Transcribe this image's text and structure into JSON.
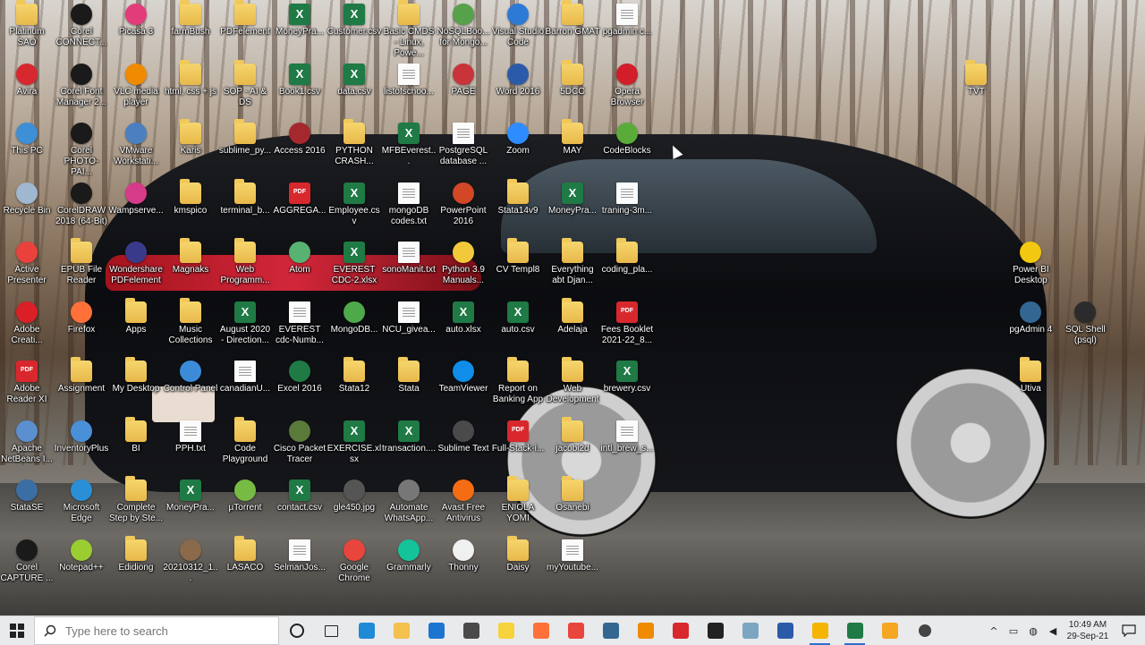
{
  "desktop": {
    "icons": [
      {
        "label": "Platinum SAO",
        "type": "folder"
      },
      {
        "label": "Corel CONNECT...",
        "type": "app",
        "color": "#1a1a1a"
      },
      {
        "label": "Picasa 3",
        "type": "app",
        "color": "#e23c7a"
      },
      {
        "label": "farmBush",
        "type": "folder"
      },
      {
        "label": "PDFelement",
        "type": "folder"
      },
      {
        "label": "MoneyPra...",
        "type": "excel"
      },
      {
        "label": "Customer.csv",
        "type": "excel"
      },
      {
        "label": "Basic CMDS - Linux, Powe...",
        "type": "folder"
      },
      {
        "label": "NoSQLBoo... for Mongo...",
        "type": "app",
        "color": "#56a14a"
      },
      {
        "label": "Visual Studio Code",
        "type": "app",
        "color": "#2c7ad6"
      },
      {
        "label": "Barron GMAT",
        "type": "folder"
      },
      {
        "label": "pgadmin c...",
        "type": "file"
      },
      {
        "label": "Avira",
        "type": "app",
        "color": "#d7282f"
      },
      {
        "label": "Corel Font Manager 2...",
        "type": "app",
        "color": "#1a1a1a"
      },
      {
        "label": "VLC media player",
        "type": "app",
        "color": "#f08a00"
      },
      {
        "label": "html, css + js",
        "type": "folder"
      },
      {
        "label": "SOP - AI & DS",
        "type": "folder"
      },
      {
        "label": "Book1.csv",
        "type": "excel"
      },
      {
        "label": "data.csv",
        "type": "excel"
      },
      {
        "label": "listofschoo...",
        "type": "file"
      },
      {
        "label": "PAGE",
        "type": "app",
        "color": "#c9333a"
      },
      {
        "label": "Word 2016",
        "type": "app",
        "color": "#2b5ba8"
      },
      {
        "label": "5DCC",
        "type": "folder"
      },
      {
        "label": "Opera Browser",
        "type": "app",
        "color": "#d21d2a"
      },
      {
        "label": "TVT",
        "type": "folder"
      },
      {
        "label": "This PC",
        "type": "app",
        "color": "#3d8fd6"
      },
      {
        "label": "Corel PHOTO-PAI...",
        "type": "app",
        "color": "#1a1a1a"
      },
      {
        "label": "VMware Workstati...",
        "type": "app",
        "color": "#4c7fc0"
      },
      {
        "label": "Karis",
        "type": "folder"
      },
      {
        "label": "sublime_py...",
        "type": "folder"
      },
      {
        "label": "Access 2016",
        "type": "app",
        "color": "#a6282f"
      },
      {
        "label": "PYTHON CRASH...",
        "type": "folder"
      },
      {
        "label": "MFBEverest...",
        "type": "excel"
      },
      {
        "label": "PostgreSQL database ...",
        "type": "file"
      },
      {
        "label": "Zoom",
        "type": "app",
        "color": "#2d8cff"
      },
      {
        "label": "MAY",
        "type": "folder"
      },
      {
        "label": "CodeBlocks",
        "type": "app",
        "color": "#5bab3a"
      },
      {
        "label": "Recycle Bin",
        "type": "app",
        "color": "#9fb7cf"
      },
      {
        "label": "CorelDRAW 2018 (64-Bit)",
        "type": "app",
        "color": "#1a1a1a"
      },
      {
        "label": "Wampserve...",
        "type": "app",
        "color": "#d63b8a"
      },
      {
        "label": "kmspico",
        "type": "folder"
      },
      {
        "label": "terminal_b...",
        "type": "folder"
      },
      {
        "label": "AGGREGA...",
        "type": "pdf"
      },
      {
        "label": "Employee.csv",
        "type": "excel"
      },
      {
        "label": "mongoDB codes.txt",
        "type": "file"
      },
      {
        "label": "PowerPoint 2016",
        "type": "app",
        "color": "#d24726"
      },
      {
        "label": "Stata14v9",
        "type": "folder"
      },
      {
        "label": "MoneyPra...",
        "type": "excel"
      },
      {
        "label": "traning-3m...",
        "type": "file"
      },
      {
        "label": "Active Presenter",
        "type": "app",
        "color": "#e9413c"
      },
      {
        "label": "EPUB File Reader",
        "type": "folder"
      },
      {
        "label": "Wondershare PDFelement",
        "type": "app",
        "color": "#3a3a8a"
      },
      {
        "label": "Magnaks",
        "type": "folder"
      },
      {
        "label": "Web Programm...",
        "type": "folder"
      },
      {
        "label": "Atom",
        "type": "app",
        "color": "#58b272"
      },
      {
        "label": "EVEREST CDC-2.xlsx",
        "type": "excel"
      },
      {
        "label": "sonoManit.txt",
        "type": "file"
      },
      {
        "label": "Python 3.9 Manuals...",
        "type": "app",
        "color": "#f2c93b"
      },
      {
        "label": "CV Templ8",
        "type": "folder"
      },
      {
        "label": "Everything abt Djan...",
        "type": "folder"
      },
      {
        "label": "coding_pla...",
        "type": "folder"
      },
      {
        "label": "Power BI Desktop",
        "type": "app",
        "color": "#f2c811"
      },
      {
        "label": "Adobe Creati...",
        "type": "app",
        "color": "#da1f26"
      },
      {
        "label": "Firefox",
        "type": "app",
        "color": "#ff7139"
      },
      {
        "label": "Apps",
        "type": "folder"
      },
      {
        "label": "Music Collections",
        "type": "folder"
      },
      {
        "label": "August 2020 - Direction...",
        "type": "excel"
      },
      {
        "label": "EVEREST cdc-Numb...",
        "type": "file"
      },
      {
        "label": "MongoDB...",
        "type": "app",
        "color": "#4ea94b"
      },
      {
        "label": "NCU_givea...",
        "type": "file"
      },
      {
        "label": "auto.xlsx",
        "type": "excel"
      },
      {
        "label": "auto.csv",
        "type": "excel"
      },
      {
        "label": "Adelaja",
        "type": "folder"
      },
      {
        "label": "Fees Booklet 2021-22_8...",
        "type": "pdf"
      },
      {
        "label": "pgAdmin 4",
        "type": "app",
        "color": "#336791"
      },
      {
        "label": "SQL Shell (psql)",
        "type": "app",
        "color": "#2b2b2b"
      },
      {
        "label": "Adobe Reader XI",
        "type": "pdf"
      },
      {
        "label": "Assignment",
        "type": "folder"
      },
      {
        "label": "My Desktop",
        "type": "folder"
      },
      {
        "label": "Control Panel",
        "type": "app",
        "color": "#3c8bd9"
      },
      {
        "label": "canadianU...",
        "type": "file"
      },
      {
        "label": "Excel 2016",
        "type": "app",
        "color": "#1f7a45"
      },
      {
        "label": "Stata12",
        "type": "folder"
      },
      {
        "label": "Stata",
        "type": "folder"
      },
      {
        "label": "TeamViewer",
        "type": "app",
        "color": "#0e8ee9"
      },
      {
        "label": "Report on Banking App",
        "type": "folder"
      },
      {
        "label": "Web Development",
        "type": "folder"
      },
      {
        "label": "brewery.csv",
        "type": "excel"
      },
      {
        "label": "Utiva",
        "type": "folder"
      },
      {
        "label": "Apache NetBeans I...",
        "type": "app",
        "color": "#5b8fd0"
      },
      {
        "label": "InventoryPlus",
        "type": "app",
        "color": "#4a90d9"
      },
      {
        "label": "BI",
        "type": "folder"
      },
      {
        "label": "PPH.txt",
        "type": "file"
      },
      {
        "label": "Code Playground",
        "type": "folder"
      },
      {
        "label": "Cisco Packet Tracer",
        "type": "app",
        "color": "#5a7a3a"
      },
      {
        "label": "EXERCISE.xlsx",
        "type": "excel"
      },
      {
        "label": "transaction....",
        "type": "excel"
      },
      {
        "label": "Sublime Text",
        "type": "app",
        "color": "#4a4a4a"
      },
      {
        "label": "Full-Stack-i...",
        "type": "pdf"
      },
      {
        "label": "jacobi2d",
        "type": "folder"
      },
      {
        "label": "intl_brew_s...",
        "type": "file"
      },
      {
        "label": "StataSE",
        "type": "app",
        "color": "#3a6ea5"
      },
      {
        "label": "Microsoft Edge",
        "type": "app",
        "color": "#2a8fd6"
      },
      {
        "label": "Complete Step by Ste...",
        "type": "folder"
      },
      {
        "label": "MoneyPra...",
        "type": "excel"
      },
      {
        "label": "µTorrent",
        "type": "app",
        "color": "#77bb44"
      },
      {
        "label": "contact.csv",
        "type": "excel"
      },
      {
        "label": "gle450.jpg",
        "type": "app",
        "color": "#555555"
      },
      {
        "label": "Automate WhatsApp...",
        "type": "app",
        "color": "#777777"
      },
      {
        "label": "Avast Free Antivirus",
        "type": "app",
        "color": "#f56c13"
      },
      {
        "label": "ENIOLA YOMI",
        "type": "folder"
      },
      {
        "label": "Osanebi",
        "type": "folder"
      },
      {
        "label": "Corel CAPTURE ...",
        "type": "app",
        "color": "#1a1a1a"
      },
      {
        "label": "Notepad++",
        "type": "app",
        "color": "#9acd32"
      },
      {
        "label": "Edidiong",
        "type": "folder"
      },
      {
        "label": "20210312_1...",
        "type": "app",
        "color": "#8a6a4a"
      },
      {
        "label": "LASACO",
        "type": "folder"
      },
      {
        "label": "SelmanJos...",
        "type": "file"
      },
      {
        "label": "Google Chrome",
        "type": "app",
        "color": "#e8453c"
      },
      {
        "label": "Grammarly",
        "type": "app",
        "color": "#15c39a"
      },
      {
        "label": "Thonny",
        "type": "app",
        "color": "#f0f0f0"
      },
      {
        "label": "Daisy",
        "type": "folder"
      },
      {
        "label": "myYoutube...",
        "type": "file"
      }
    ]
  },
  "taskbar": {
    "search_placeholder": "Type here to search",
    "pinned": [
      {
        "name": "cortana-icon",
        "color": "#222222",
        "active": false
      },
      {
        "name": "task-view-icon",
        "color": "#222222",
        "active": false
      },
      {
        "name": "edge-icon",
        "color": "#1f8ad6",
        "active": false
      },
      {
        "name": "file-explorer-icon",
        "color": "#f2c14e",
        "active": false
      },
      {
        "name": "mail-icon",
        "color": "#1c75d0",
        "active": false
      },
      {
        "name": "store-icon",
        "color": "#4a4a4a",
        "active": false
      },
      {
        "name": "sticky-notes-icon",
        "color": "#f7d33b",
        "active": false
      },
      {
        "name": "firefox-icon",
        "color": "#ff7139",
        "active": false
      },
      {
        "name": "chrome-icon",
        "color": "#e8453c",
        "active": false
      },
      {
        "name": "pgadmin-icon",
        "color": "#336791",
        "active": false
      },
      {
        "name": "vlc-icon",
        "color": "#f08a00",
        "active": false
      },
      {
        "name": "acrobat-icon",
        "color": "#d8282d",
        "active": false
      },
      {
        "name": "terminal-icon",
        "color": "#222222",
        "active": false
      },
      {
        "name": "notepad-icon",
        "color": "#7aa6c2",
        "active": false
      },
      {
        "name": "word-icon",
        "color": "#2b5ba8",
        "active": false
      },
      {
        "name": "recorder-icon",
        "color": "#f5b400",
        "active": true
      },
      {
        "name": "excel-icon",
        "color": "#1f7a45",
        "active": true
      },
      {
        "name": "sublime-icon",
        "color": "#f5a623",
        "active": false
      },
      {
        "name": "settings-icon",
        "color": "#444444",
        "active": false
      }
    ],
    "tray": {
      "time": "10:49 AM",
      "date": "29-Sep-21"
    }
  }
}
